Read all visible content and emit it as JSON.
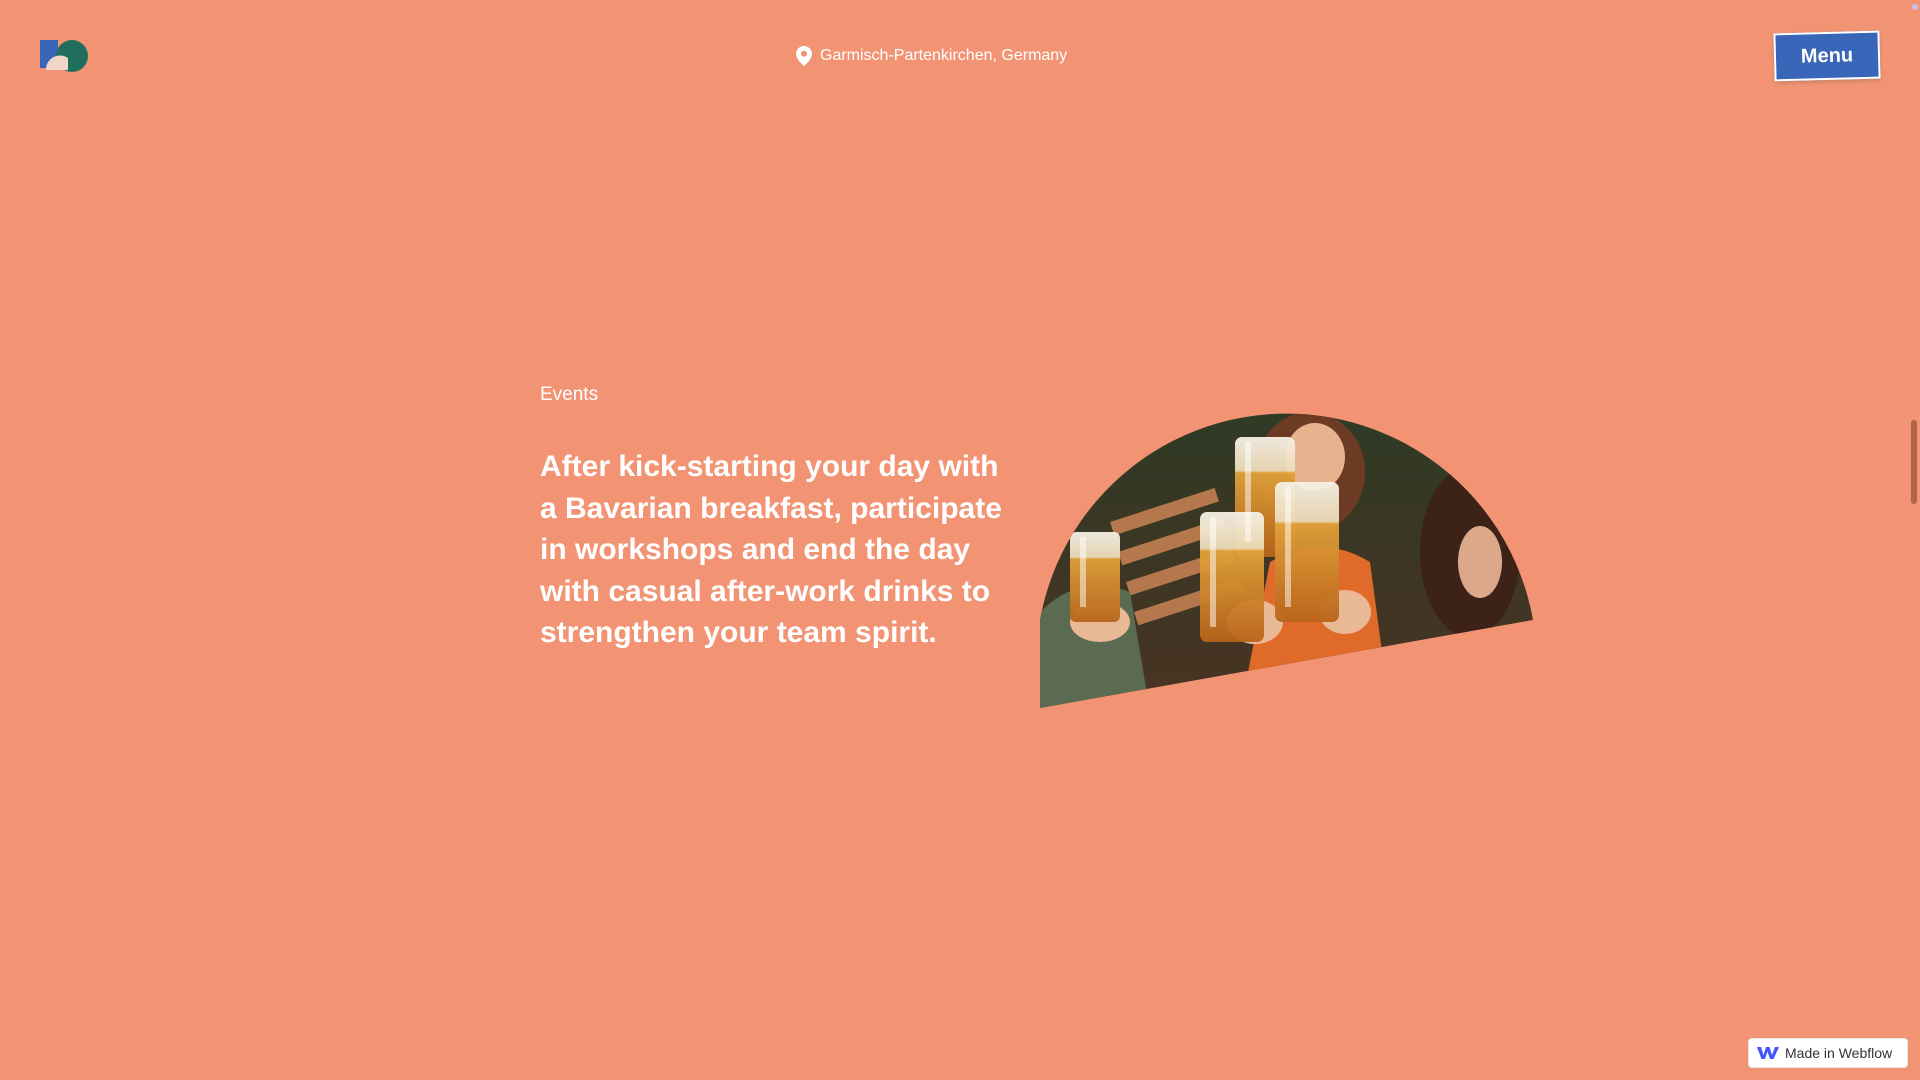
{
  "header": {
    "logo_icon": "site-logo",
    "location_icon": "map-pin-icon",
    "location_text": "Garmisch-Partenkirchen, Germany",
    "menu_label": "Menu"
  },
  "main": {
    "section_label": "Events",
    "headline": "After kick-starting your day with a Bavarian breakfast, participate in workshops and end the day with casual after-work drinks to strengthen your team spirit.",
    "image_alt": "Group toasting with beer glasses"
  },
  "badge": {
    "label": "Made in Webflow",
    "icon": "webflow-logo-icon"
  },
  "colors": {
    "background": "#f29474",
    "menu_button": "#3a66ba",
    "logo_blue": "#3a66ba",
    "logo_green": "#1f6f5c",
    "text": "#ffffff"
  }
}
